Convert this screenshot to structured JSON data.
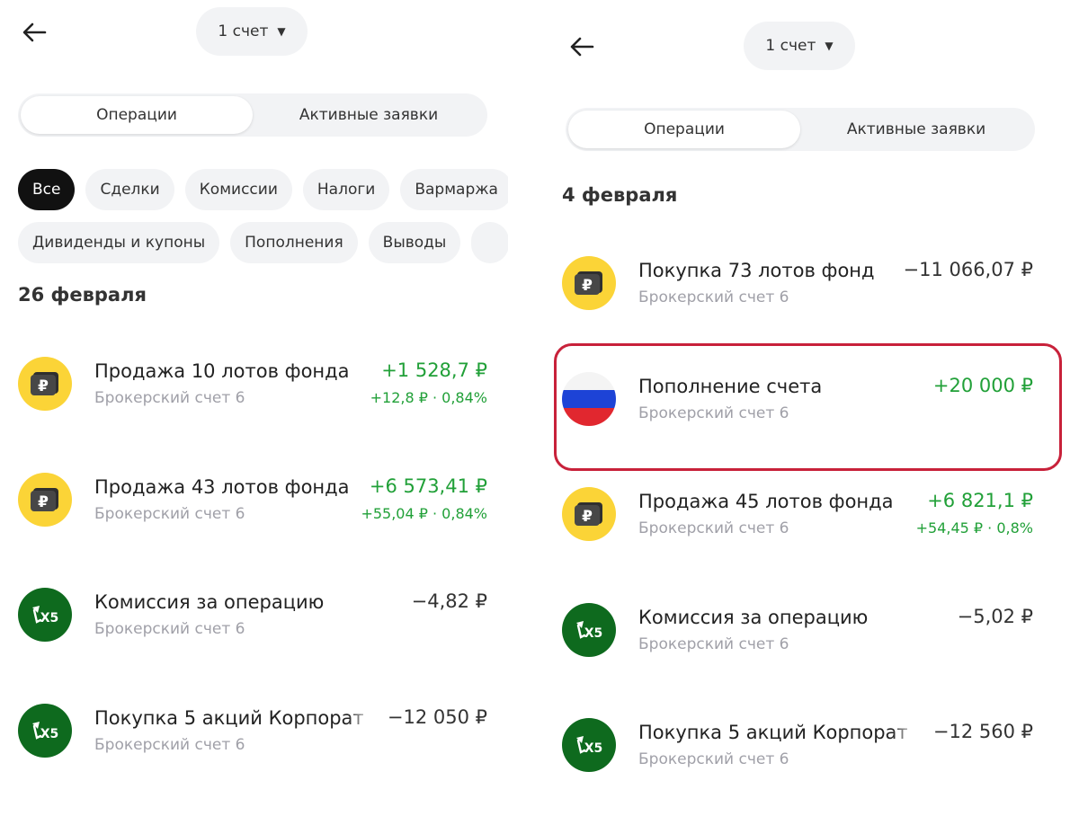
{
  "left": {
    "account_label": "1 счет",
    "tabs": [
      "Операции",
      "Активные заявки"
    ],
    "filters_row1": [
      "Все",
      "Сделки",
      "Комиссии",
      "Налоги",
      "Вармаржа"
    ],
    "filters_row2": [
      "Дивиденды и купоны",
      "Пополнения",
      "Выводы"
    ],
    "date": "26 февраля",
    "operations": [
      {
        "icon": "ruble-fund-icon",
        "title": "Продажа 10 лотов фонда",
        "subtitle": "Брокерский счет 6",
        "amount": "+1 528,7 ₽",
        "amount_type": "positive",
        "extra": "+12,8 ₽ · 0,84%"
      },
      {
        "icon": "ruble-fund-icon",
        "title": "Продажа 43 лотов фонда",
        "subtitle": "Брокерский счет 6",
        "amount": "+6 573,41 ₽",
        "amount_type": "positive",
        "extra": "+55,04 ₽ · 0,84%"
      },
      {
        "icon": "x5-logo-icon",
        "title": "Комиссия за операцию",
        "subtitle": "Брокерский счет 6",
        "amount": "−4,82 ₽",
        "amount_type": "negative",
        "extra": ""
      },
      {
        "icon": "x5-logo-icon",
        "title": "Покупка 5 акций Корпорат",
        "subtitle": "Брокерский счет 6",
        "amount": "−12 050 ₽",
        "amount_type": "negative",
        "extra": ""
      }
    ]
  },
  "right": {
    "account_label": "1 счет",
    "tabs": [
      "Операции",
      "Активные заявки"
    ],
    "date": "4 февраля",
    "operations": [
      {
        "icon": "ruble-fund-icon",
        "title": "Покупка 73 лотов фонд",
        "subtitle": "Брокерский счет 6",
        "amount": "−11 066,07 ₽",
        "amount_type": "negative",
        "extra": ""
      },
      {
        "icon": "russia-flag-icon",
        "title": "Пополнение счета",
        "subtitle": "Брокерский счет 6",
        "amount": "+20 000 ₽",
        "amount_type": "positive",
        "extra": ""
      },
      {
        "icon": "ruble-fund-icon",
        "title": "Продажа 45 лотов фонда",
        "subtitle": "Брокерский счет 6",
        "amount": "+6 821,1 ₽",
        "amount_type": "positive",
        "extra": "+54,45 ₽ · 0,8%"
      },
      {
        "icon": "x5-logo-icon",
        "title": "Комиссия за операцию",
        "subtitle": "Брокерский счет 6",
        "amount": "−5,02 ₽",
        "amount_type": "negative",
        "extra": ""
      },
      {
        "icon": "x5-logo-icon",
        "title": "Покупка 5 акций Корпорат",
        "subtitle": "Брокерский счет 6",
        "amount": "−12 560 ₽",
        "amount_type": "negative",
        "extra": ""
      }
    ]
  },
  "colors": {
    "positive": "#21a038",
    "highlight": "#c8213a",
    "fund_yellow": "#fbd437",
    "x5_green": "#0e6a1e"
  }
}
